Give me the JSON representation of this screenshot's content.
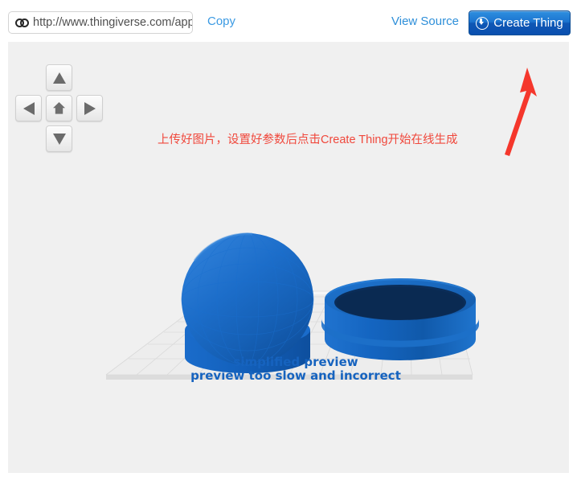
{
  "topbar": {
    "url_value": "http://www.thingiverse.com/apps",
    "url_placeholder": "http://",
    "link_icon": "chain-link-icon",
    "copy_label": "Copy",
    "view_source_label": "View Source",
    "create_thing_label": "Create Thing",
    "create_thing_icon": "download-circle-icon",
    "accent_blue": "#1c74cf",
    "link_blue": "#3b9ae3"
  },
  "nav_pad": {
    "up": {
      "name": "pan-up-button",
      "icon": "triangle-up-icon"
    },
    "left": {
      "name": "pan-left-button",
      "icon": "triangle-left-icon"
    },
    "home": {
      "name": "reset-view-button",
      "icon": "home-icon"
    },
    "right": {
      "name": "pan-right-button",
      "icon": "triangle-right-icon"
    },
    "down": {
      "name": "pan-down-button",
      "icon": "triangle-down-icon"
    }
  },
  "annotation": {
    "text": "上传好图片，设置好参数后点击Create Thing开始在线生成",
    "color": "#f0483c",
    "arrow": "red-arrow-pointing-to-create-thing"
  },
  "viewer": {
    "background": "#f0f0f0",
    "platform_color": "#e9e9e9",
    "model_color": "#1569c7",
    "label_line1": "simplified preview",
    "label_line2": "preview too slow and incorrect",
    "label_color": "#1663bf",
    "objects": [
      {
        "name": "sphere-on-cylinder-base",
        "shape": "sphere"
      },
      {
        "name": "open-cylinder-ring",
        "shape": "ring"
      }
    ]
  }
}
